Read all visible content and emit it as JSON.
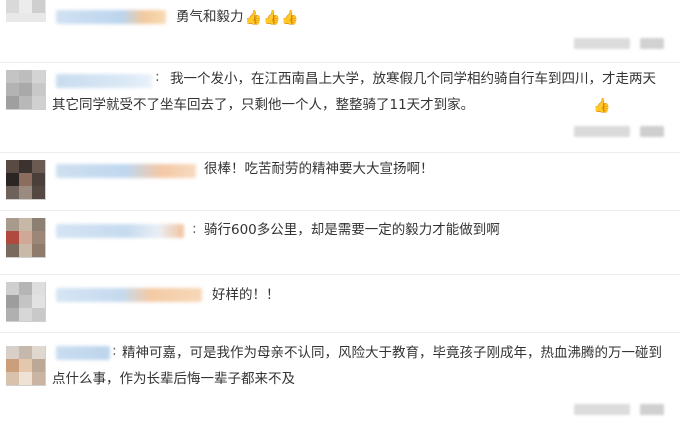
{
  "comments": [
    {
      "text": "勇气和毅力",
      "emoji_count": 3,
      "emoji_name": "thumbs-up-icon"
    },
    {
      "text": "我一个发小，在江西南昌上大学，放寒假几个同学相约骑自行车到四川，才走两天其它同学就受不了坐车回去了，只剩他一个人，整整骑了11天才到家。",
      "emoji_count": 1,
      "emoji_name": "thumbs-up-icon"
    },
    {
      "text": "很棒！吃苦耐劳的精神要大大宣扬啊！",
      "emoji_count": 0
    },
    {
      "text": "骑行600多公里，却是需要一定的毅力才能做到啊",
      "emoji_count": 0
    },
    {
      "text": "好样的！！",
      "emoji_count": 0
    },
    {
      "text": "精神可嘉，可是我作为母亲不认同，风险大于教育，毕竟孩子刚成年，热血沸腾的万一碰到点什么事，作为长辈后悔一辈子都来不及",
      "emoji_count": 0
    }
  ],
  "colors": {
    "text": "#333333",
    "name_blur_blue": "#c9def1",
    "name_blur_orange": "#f5c9a4",
    "meta_gray": "#d6d6d6",
    "emoji_gold": "#e9b24a"
  }
}
